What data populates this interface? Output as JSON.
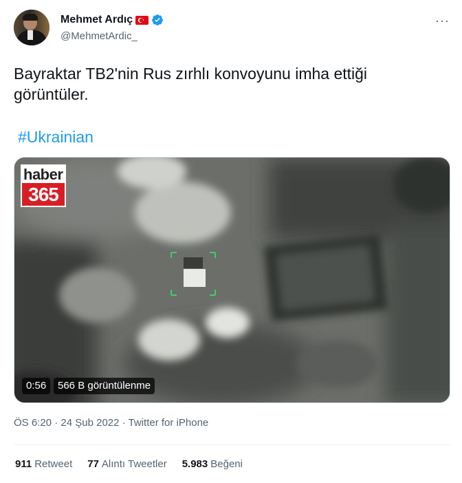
{
  "author": {
    "name": "Mehmet Ardıç",
    "handle": "@MehmetArdic_",
    "flag_icon": "turkey-flag-icon",
    "verified_icon": "verified-badge-icon"
  },
  "more_icon": "more-options-icon",
  "more_label": "···",
  "tweet": {
    "text": "Bayraktar TB2'nin Rus zırhlı konvoyunu  imha ettiği görüntüler.",
    "hashtag": "#Ukrainian"
  },
  "media": {
    "logo_top": "haber",
    "logo_bottom": "365",
    "duration": "0:56",
    "views": "566 B görüntülenme"
  },
  "meta": {
    "time": "ÖS 6:20",
    "separator": "·",
    "date": "24 Şub 2022",
    "source": "Twitter for iPhone"
  },
  "stats": {
    "retweets_count": "911",
    "retweets_label": "Retweet",
    "quotes_count": "77",
    "quotes_label": "Alıntı Tweetler",
    "likes_count": "5.983",
    "likes_label": "Beğeni"
  },
  "colors": {
    "accent": "#1d9bf0",
    "secondary_text": "#536471",
    "primary_text": "#0f1419",
    "logo_red": "#d81e25"
  }
}
